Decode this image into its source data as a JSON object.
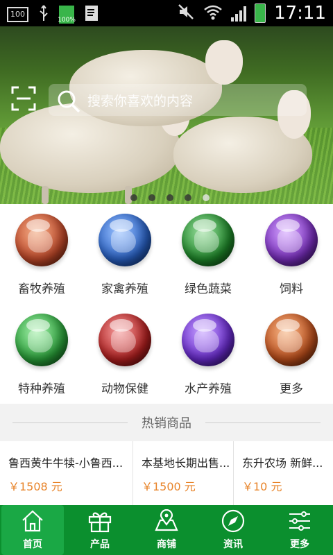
{
  "status_bar": {
    "notif_label": "100",
    "battery_small_label": "100%",
    "time": "17:11"
  },
  "search": {
    "placeholder": "搜索你喜欢的内容"
  },
  "banner": {
    "slide_count": 5,
    "active_slide": 5
  },
  "categories": [
    {
      "label": "畜牧养殖",
      "color": "#c44a2a",
      "icon": "globe-icon"
    },
    {
      "label": "家禽养殖",
      "color": "#2a63c8",
      "icon": "globe-icon"
    },
    {
      "label": "绿色蔬菜",
      "color": "#1f8a2a",
      "icon": "globe-icon"
    },
    {
      "label": "饲料",
      "color": "#7b2fc1",
      "icon": "globe-icon"
    },
    {
      "label": "特种养殖",
      "color": "#2aa33a",
      "icon": "globe-icon"
    },
    {
      "label": "动物保健",
      "color": "#b52020",
      "icon": "globe-icon"
    },
    {
      "label": "水产养殖",
      "color": "#6a2bd0",
      "icon": "globe-icon"
    },
    {
      "label": "更多",
      "color": "#c0501c",
      "icon": "globe-icon"
    }
  ],
  "hot_section": {
    "title": "热销商品"
  },
  "products": [
    {
      "name": "鲁西黄牛牛犊-小鲁西...",
      "price": "￥1508 元"
    },
    {
      "name": "本基地长期出售...",
      "price": "￥1500 元"
    },
    {
      "name": "东升农场 新鲜...",
      "price": "￥10 元"
    }
  ],
  "tabs": [
    {
      "label": "首页",
      "icon": "home-icon"
    },
    {
      "label": "产品",
      "icon": "gift-icon"
    },
    {
      "label": "商铺",
      "icon": "map-icon"
    },
    {
      "label": "资讯",
      "icon": "compass-icon"
    },
    {
      "label": "更多",
      "icon": "sliders-icon"
    }
  ],
  "colors": {
    "tab_bar": "#0b8f2e",
    "price": "#e8842a"
  }
}
